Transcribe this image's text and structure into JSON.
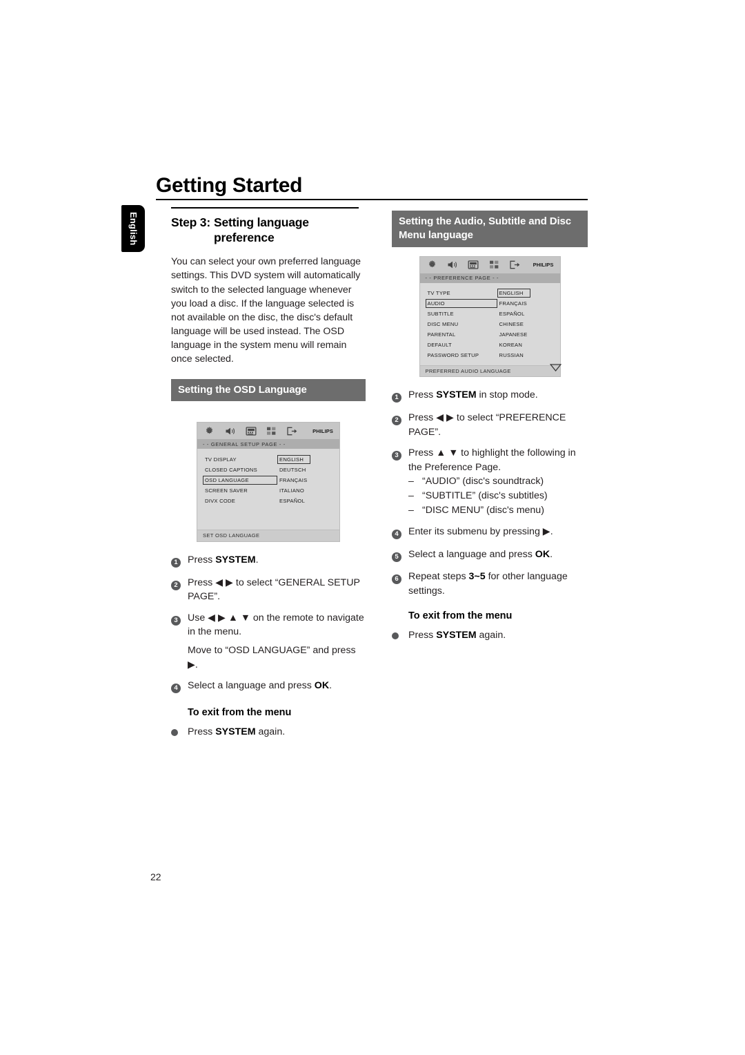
{
  "document": {
    "page_title": "Getting Started",
    "side_tab": "English",
    "page_number": "22"
  },
  "left_column": {
    "step_label": "Step 3:",
    "step_title_line1": "Setting language",
    "step_title_line2": "preference",
    "intro": "You can select your own preferred language settings. This DVD system will automatically switch to the selected language whenever you load a disc. If the language selected is not available on the disc, the disc's default language will be used instead. The OSD language in the system menu will remain once selected.",
    "banner": "Setting the OSD Language",
    "osd": {
      "page_bar": "- -  GENERAL  SETUP  PAGE  - -",
      "philips_logo": "PHILIPS",
      "footer": "SET OSD LANGUAGE",
      "icons": [
        "gear-icon",
        "speaker-icon",
        "tv-screen-icon",
        "grid-icon",
        "exit-arrow-icon"
      ],
      "rows": [
        {
          "left": "TV DISPLAY",
          "left_selected": false,
          "right": "ENGLISH",
          "right_selected": true
        },
        {
          "left": "CLOSED CAPTIONS",
          "left_selected": false,
          "right": "DEUTSCH",
          "right_selected": false
        },
        {
          "left": "OSD LANGUAGE",
          "left_selected": true,
          "right": "FRANÇAIS",
          "right_selected": false
        },
        {
          "left": "SCREEN SAVER",
          "left_selected": false,
          "right": "ITALIANO",
          "right_selected": false
        },
        {
          "left": "DIVX CODE",
          "left_selected": false,
          "right": "ESPAÑOL",
          "right_selected": false
        }
      ]
    },
    "steps": [
      {
        "num": "1",
        "parts": [
          {
            "t": "Press ",
            "b": false
          },
          {
            "t": "SYSTEM",
            "b": true
          },
          {
            "t": ".",
            "b": false
          }
        ]
      },
      {
        "num": "2",
        "parts": [
          {
            "t": "Press ◀ ▶ to select “GENERAL SETUP PAGE”.",
            "b": false
          }
        ]
      },
      {
        "num": "3",
        "parts": [
          {
            "t": "Use ◀ ▶ ▲ ▼ on the remote to navigate in the menu.",
            "b": false
          }
        ]
      }
    ],
    "step3_continuation": "Move to “OSD LANGUAGE” and press ▶.",
    "step4": {
      "num": "4",
      "pre": "Select a language and press ",
      "key": "OK",
      "post": "."
    },
    "exit_heading": "To exit from the menu",
    "exit_bullet": {
      "pre": "Press ",
      "key": "SYSTEM",
      "post": " again."
    }
  },
  "right_column": {
    "banner_line1": "Setting the Audio, Subtitle and Disc",
    "banner_line2": "Menu language",
    "osd": {
      "page_bar": "- -  PREFERENCE  PAGE  - -",
      "philips_logo": "PHILIPS",
      "footer": "PREFERRED AUDIO LANGUAGE",
      "icons": [
        "gear-icon",
        "speaker-icon",
        "tv-screen-icon",
        "grid-icon",
        "exit-arrow-icon"
      ],
      "rows": [
        {
          "left": "TV TYPE",
          "left_selected": false,
          "right": "ENGLISH",
          "right_selected": true
        },
        {
          "left": "AUDIO",
          "left_selected": true,
          "right": "FRANÇAIS",
          "right_selected": false
        },
        {
          "left": "SUBTITLE",
          "left_selected": false,
          "right": "ESPAÑOL",
          "right_selected": false
        },
        {
          "left": "DISC MENU",
          "left_selected": false,
          "right": "CHINESE",
          "right_selected": false
        },
        {
          "left": "PARENTAL",
          "left_selected": false,
          "right": "JAPANESE",
          "right_selected": false
        },
        {
          "left": "DEFAULT",
          "left_selected": false,
          "right": "KOREAN",
          "right_selected": false
        },
        {
          "left": "PASSWORD SETUP",
          "left_selected": false,
          "right": "RUSSIAN",
          "right_selected": false
        }
      ],
      "scroll_indicator": "down-arrow-icon"
    },
    "steps": [
      {
        "num": "1",
        "parts": [
          {
            "t": "Press ",
            "b": false
          },
          {
            "t": "SYSTEM",
            "b": true
          },
          {
            "t": " in stop mode.",
            "b": false
          }
        ]
      },
      {
        "num": "2",
        "parts": [
          {
            "t": "Press ◀ ▶ to select “PREFERENCE PAGE”.",
            "b": false
          }
        ]
      },
      {
        "num": "3",
        "parts": [
          {
            "t": "Press ▲ ▼ to highlight the following in the Preference Page.",
            "b": false
          }
        ]
      }
    ],
    "step3_sublist": [
      "“AUDIO” (disc's soundtrack)",
      "“SUBTITLE” (disc's subtitles)",
      "“DISC MENU” (disc's menu)"
    ],
    "step4": {
      "num": "4",
      "text": "Enter its submenu by pressing ▶."
    },
    "step5": {
      "num": "5",
      "pre": "Select a language and press ",
      "key": "OK",
      "post": "."
    },
    "step6": {
      "num": "6",
      "pre": "Repeat steps ",
      "key": "3~5",
      "post": " for other language settings."
    },
    "exit_heading": "To exit from the menu",
    "exit_bullet": {
      "pre": "Press ",
      "key": "SYSTEM",
      "post": " again."
    }
  },
  "colors": {
    "banner_bg": "#6d6d6d",
    "osd_body_bg": "#d9d9d9",
    "osd_iconbar_bg": "#c6c6c6",
    "osd_pagebar_bg": "#adadad",
    "bullet_bg": "#58595b"
  }
}
